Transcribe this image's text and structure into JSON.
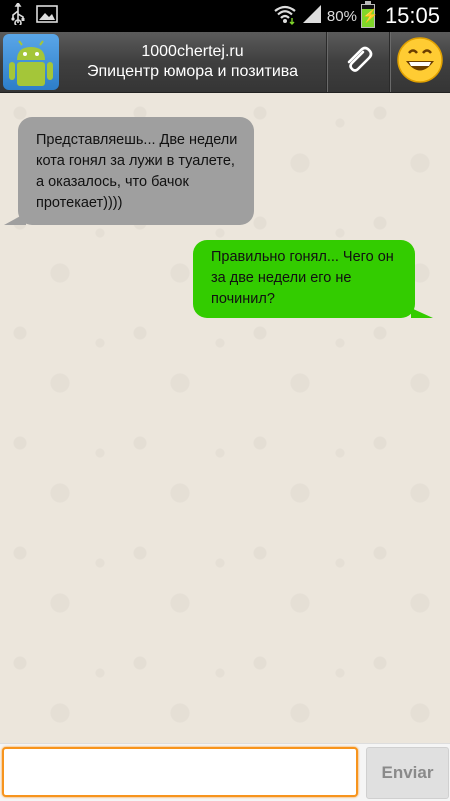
{
  "status_bar": {
    "icons": [
      "usb-icon",
      "image-icon",
      "wifi-icon",
      "signal-icon",
      "battery-charging-icon"
    ],
    "battery_percent": "80%",
    "battery_level": 0.8,
    "time": "15:05"
  },
  "header": {
    "avatar_icon": "android-robot-icon",
    "title": "1000chertej.ru",
    "subtitle": "Эпицентр юмора и позитива",
    "attach_icon": "paperclip-icon",
    "emoji_icon": "smiley-icon"
  },
  "messages": [
    {
      "direction": "incoming",
      "text": "Представляешь... Две недели кота гонял за лужи в туалете, а оказалось, что бачок протекает))))",
      "color": "#9f9f9f"
    },
    {
      "direction": "outgoing",
      "text": "Правильно гонял... Чего он за две недели его не починил?",
      "color": "#33cc00"
    }
  ],
  "composer": {
    "placeholder": "",
    "send_label": "Enviar",
    "accent": "#f7941d"
  }
}
